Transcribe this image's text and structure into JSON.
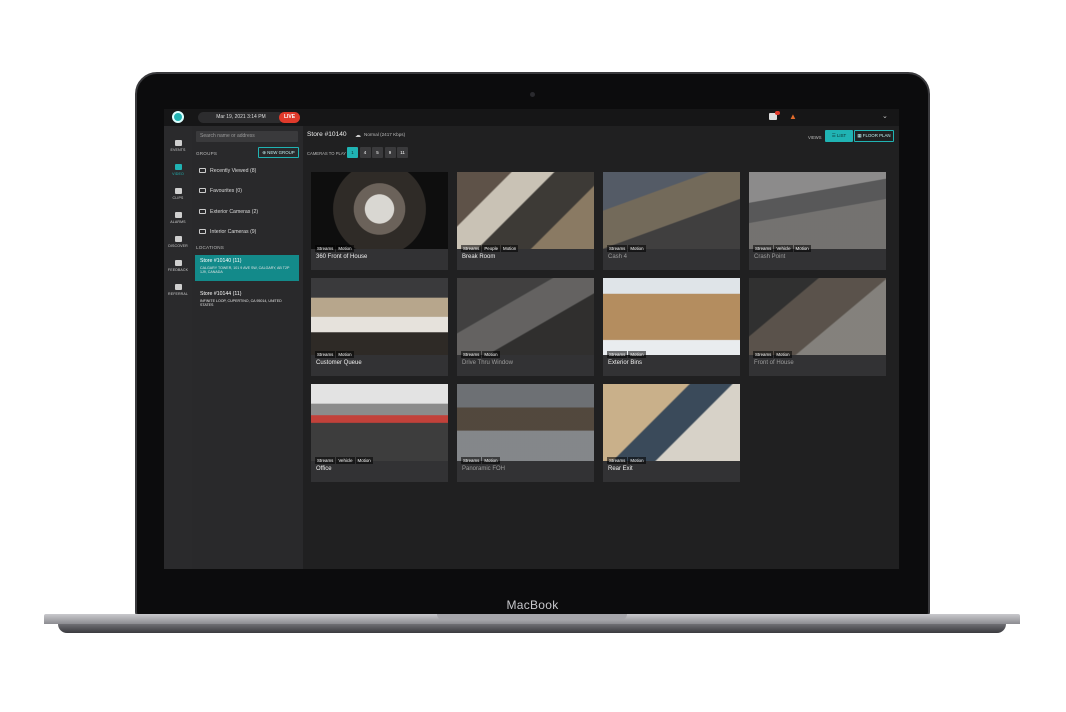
{
  "device": {
    "brand": "MacBook"
  },
  "topbar": {
    "datetime": "Mar 19, 2021 3:14 PM",
    "live": "LIVE"
  },
  "nav": [
    {
      "label": "EVENTS",
      "icon": "events-icon"
    },
    {
      "label": "VIDEO",
      "icon": "video-icon"
    },
    {
      "label": "CLIPS",
      "icon": "clips-icon"
    },
    {
      "label": "ALARMS",
      "icon": "alarms-icon"
    },
    {
      "label": "DISCOVER",
      "icon": "discover-icon"
    },
    {
      "label": "FEEDBACK",
      "icon": "feedback-icon"
    },
    {
      "label": "REFERRAL",
      "icon": "referral-icon"
    }
  ],
  "sidebar": {
    "search_placeholder": "Search name or address",
    "groups_label": "GROUPS",
    "new_group": "NEW GROUP",
    "groups": [
      "Recently Viewed (8)",
      "Favourites (0)",
      "Exterior Cameras (2)",
      "Interior Cameras (9)"
    ],
    "locations_label": "LOCATIONS",
    "locations": [
      {
        "name": "Store #10140 (11)",
        "address": "CALGARY TOWER, 101 9 AVE SW, CALGARY, AB T2P 1J9, CANADA"
      },
      {
        "name": "Store #10144 (11)",
        "address": "INFINITE LOOP, CUPERTINO, CA 95014, UNITED STATES"
      }
    ]
  },
  "main": {
    "title": "Store #10140",
    "status": "Normal (2417 Kbps)",
    "views_label": "VIEWS",
    "list_label": "LIST",
    "floor_plan_label": "FLOOR PLAN",
    "cameras_to_play_label": "CAMERAS TO PLAY",
    "cameras_to_play": [
      "1",
      "4",
      "5",
      "9",
      "11"
    ],
    "selected_cameras_to_play": "1",
    "tiles": [
      {
        "name": "360 Front of House",
        "tags": [
          "Streams",
          "Motion"
        ],
        "dim": false
      },
      {
        "name": "Break Room",
        "tags": [
          "Streams",
          "People",
          "Motion"
        ],
        "dim": false
      },
      {
        "name": "Cash 4",
        "tags": [
          "Streams",
          "Motion"
        ],
        "dim": true
      },
      {
        "name": "Crash Point",
        "tags": [
          "Streams",
          "Vehicle",
          "Motion"
        ],
        "dim": true
      },
      {
        "name": "Customer Queue",
        "tags": [
          "Streams",
          "Motion"
        ],
        "dim": false
      },
      {
        "name": "Drive Thru Window",
        "tags": [
          "Streams",
          "Motion"
        ],
        "dim": true
      },
      {
        "name": "Exterior Bins",
        "tags": [
          "Streams",
          "Motion"
        ],
        "dim": false
      },
      {
        "name": "Front of House",
        "tags": [
          "Streams",
          "Motion"
        ],
        "dim": true
      },
      {
        "name": "Office",
        "tags": [
          "Streams",
          "Vehicle",
          "Motion"
        ],
        "dim": false
      },
      {
        "name": "Panoramic FOH",
        "tags": [
          "Streams",
          "Motion"
        ],
        "dim": true
      },
      {
        "name": "Rear Exit",
        "tags": [
          "Streams",
          "Motion"
        ],
        "dim": false
      }
    ]
  }
}
